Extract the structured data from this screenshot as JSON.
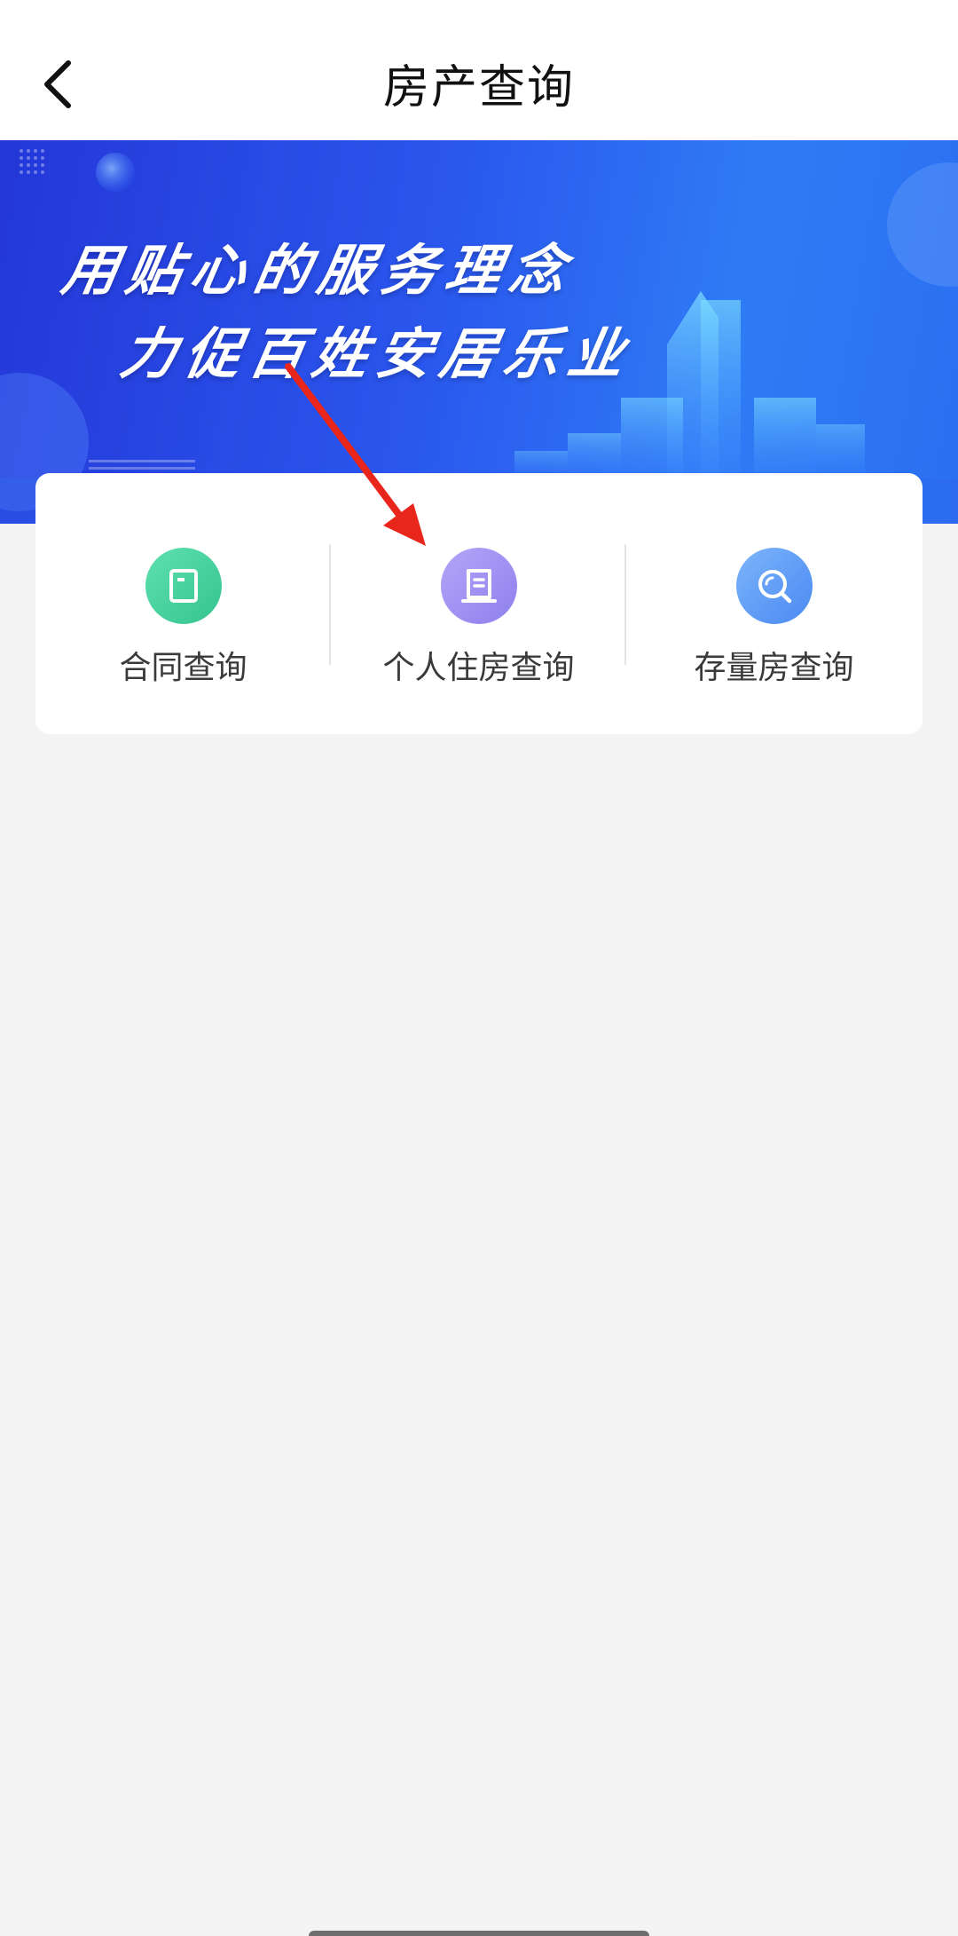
{
  "header": {
    "back_icon": "chevron-left-icon",
    "title": "房产查询"
  },
  "banner": {
    "slogan_line1": "用贴心的服务理念",
    "slogan_line2": "力促百姓安居乐业"
  },
  "services": [
    {
      "label": "合同查询",
      "icon": "contract-icon",
      "color": "#3fcf9a"
    },
    {
      "label": "个人住房查询",
      "icon": "document-icon",
      "color": "#9b8cf0"
    },
    {
      "label": "存量房查询",
      "icon": "search-icon",
      "color": "#5b9bf5"
    }
  ],
  "annotation": {
    "color": "#e8261c"
  }
}
